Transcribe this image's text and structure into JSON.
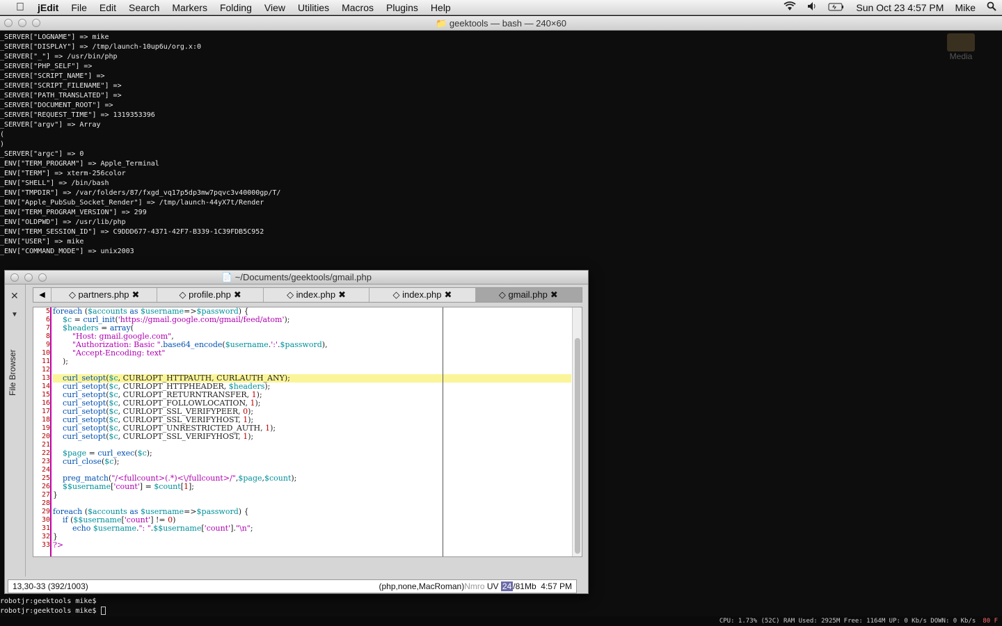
{
  "menubar": {
    "app_name": "jEdit",
    "items": [
      "File",
      "Edit",
      "Search",
      "Markers",
      "Folding",
      "View",
      "Utilities",
      "Macros",
      "Plugins",
      "Help"
    ],
    "clock": "Sun Oct 23  4:57 PM",
    "user": "Mike"
  },
  "terminal": {
    "title": "geektools — bash — 240×60",
    "output": [
      "_SERVER[\"LOGNAME\"] => mike",
      "_SERVER[\"DISPLAY\"] => /tmp/launch-10up6u/org.x:0",
      "_SERVER[\"_\"] => /usr/bin/php",
      "_SERVER[\"PHP_SELF\"] =>",
      "_SERVER[\"SCRIPT_NAME\"] =>",
      "_SERVER[\"SCRIPT_FILENAME\"] =>",
      "_SERVER[\"PATH_TRANSLATED\"] =>",
      "_SERVER[\"DOCUMENT_ROOT\"] =>",
      "_SERVER[\"REQUEST_TIME\"] => 1319353396",
      "_SERVER[\"argv\"] => Array",
      "(",
      ")",
      "",
      "_SERVER[\"argc\"] => 0",
      "_ENV[\"TERM_PROGRAM\"] => Apple_Terminal",
      "_ENV[\"TERM\"] => xterm-256color",
      "_ENV[\"SHELL\"] => /bin/bash",
      "_ENV[\"TMPDIR\"] => /var/folders/87/fxgd_vq17p5dp3mw7pqvc3v40000gp/T/",
      "_ENV[\"Apple_PubSub_Socket_Render\"] => /tmp/launch-44yX7t/Render",
      "_ENV[\"TERM_PROGRAM_VERSION\"] => 299",
      "_ENV[\"OLDPWD\"] => /usr/lib/php",
      "_ENV[\"TERM_SESSION_ID\"] => C9DDD677-4371-42F7-B339-1C39FDB5C952",
      "_ENV[\"USER\"] => mike",
      "_ENV[\"COMMAND_MODE\"] => unix2003"
    ],
    "prompt_1": "robotjr:geektools mike$",
    "prompt_2": "robotjr:geektools mike$ "
  },
  "desktop": {
    "media_label": "Media"
  },
  "geektool_status": {
    "text": "CPU: 1.73% (52C)  RAM Used: 2925M Free: 1164M  UP: 0 Kb/s DOWN: 0 Kb/s",
    "temp": "80 F"
  },
  "jedit": {
    "title": "~/Documents/geektools/gmail.php",
    "file_browser_label": "File Browser",
    "tabs": [
      {
        "label": "partners.php",
        "active": false
      },
      {
        "label": "profile.php",
        "active": false
      },
      {
        "label": "index.php",
        "active": false
      },
      {
        "label": "index.php",
        "active": false
      },
      {
        "label": "gmail.php",
        "active": true
      }
    ],
    "line_numbers": [
      "5",
      "6",
      "7",
      "8",
      "9",
      "10",
      "11",
      "12",
      "13",
      "14",
      "15",
      "16",
      "17",
      "18",
      "19",
      "20",
      "21",
      "22",
      "23",
      "24",
      "25",
      "26",
      "27",
      "28",
      "29",
      "30",
      "31",
      "32",
      "33"
    ],
    "highlight_line": 13,
    "status": {
      "caret": "13,30-33 (392/1003)",
      "mode": "(php,none,MacRoman)",
      "flags": "Nmro",
      "uv": "UV",
      "mem_used": "24",
      "mem_total": "/81Mb",
      "time": "4:57 PM"
    }
  }
}
